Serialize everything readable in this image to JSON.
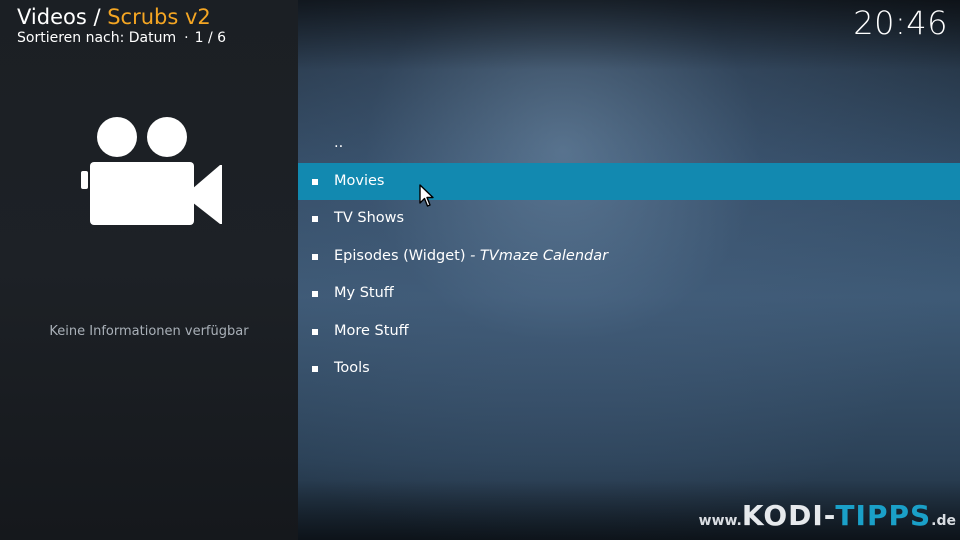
{
  "header": {
    "section": "Videos",
    "separator": " / ",
    "addon": "Scrubs v2",
    "sort_label": "Sortieren nach: Datum",
    "dot": "·",
    "page_info": "1 / 6"
  },
  "clock": "20:46",
  "info_panel": {
    "icon": "video-camera-icon",
    "text": "Keine Informationen verfügbar"
  },
  "menu": {
    "selected_index": 1,
    "items": [
      {
        "label": "..",
        "suffix": ""
      },
      {
        "label": "Movies",
        "suffix": ""
      },
      {
        "label": "TV Shows",
        "suffix": ""
      },
      {
        "label": "Episodes (Widget)",
        "suffix": " - TVmaze Calendar"
      },
      {
        "label": "My Stuff",
        "suffix": ""
      },
      {
        "label": "More Stuff",
        "suffix": ""
      },
      {
        "label": "Tools",
        "suffix": ""
      }
    ]
  },
  "watermark": {
    "www": "www.",
    "kodi": "KODI",
    "dash": "-",
    "tipps": "TIPPS",
    "tld": ".de"
  },
  "colors": {
    "accent": "#f5a623",
    "selection": "#1289b0",
    "watermark_accent": "#1aa0c8"
  }
}
